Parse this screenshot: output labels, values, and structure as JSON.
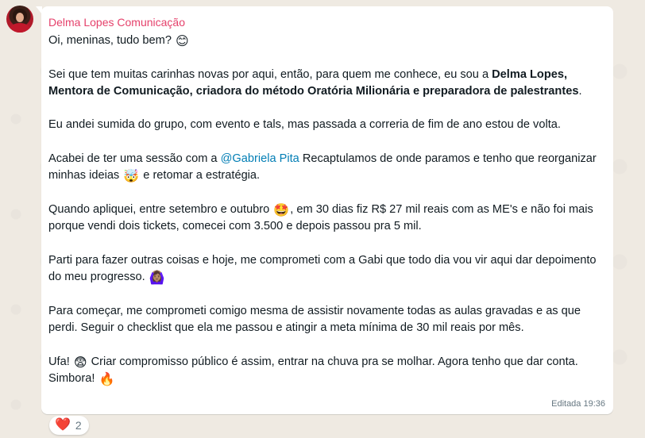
{
  "message": {
    "sender": "Delma Lopes Comunicação",
    "paragraphs": {
      "p1": {
        "text": "Oi, meninas, tudo bem?",
        "emoji": "😊"
      },
      "p2": {
        "before": "Sei que tem muitas carinhas novas por aqui, então, para quem me conhece, eu sou a ",
        "bold": "Delma Lopes, Mentora de Comunicação, criadora do método Oratória Milionária e preparadora de palestrantes",
        "after": "."
      },
      "p3": {
        "text": "Eu andei sumida do grupo, com evento e tals, mas passada a correria de fim de ano estou de volta."
      },
      "p4": {
        "before": "Acabei de ter uma sessão com a ",
        "mention": "@Gabriela Pita",
        "middle": " Recaptulamos de onde paramos e tenho que reorganizar minhas ideias",
        "emoji": "🤯",
        "after": " e retomar a estratégia."
      },
      "p5": {
        "before": "Quando apliquei, entre setembro e outubro",
        "emoji": "🤩",
        "after": ", em 30 dias fiz R$ 27 mil reais com as ME's e não foi mais porque vendi dois tickets, comecei com 3.500 e depois passou pra 5 mil."
      },
      "p6": {
        "text": "Parti para fazer outras coisas e hoje, me comprometi com a Gabi que todo dia vou vir aqui dar depoimento do meu progresso.",
        "emoji": "🙆🏽‍♀️"
      },
      "p7": {
        "text": "Para começar, me comprometi comigo mesma de assistir novamente todas as aulas gravadas e as que perdi. Seguir o checklist que ela me passou e atingir a meta mínima de 30 mil reais por mês."
      },
      "p8": {
        "before": "Ufa!",
        "emoji1": "😨",
        "middle": " Criar compromisso público é assim, entrar na chuva pra se molhar. Agora tenho que dar conta. Simbora!",
        "emoji2": "🔥"
      }
    },
    "meta": "Editada 19:36"
  },
  "reaction": {
    "emoji": "❤️",
    "count": "2"
  },
  "colors": {
    "sender": "#e5416b",
    "mention": "#027eb5",
    "background": "#efeae2",
    "bubble": "#ffffff"
  }
}
